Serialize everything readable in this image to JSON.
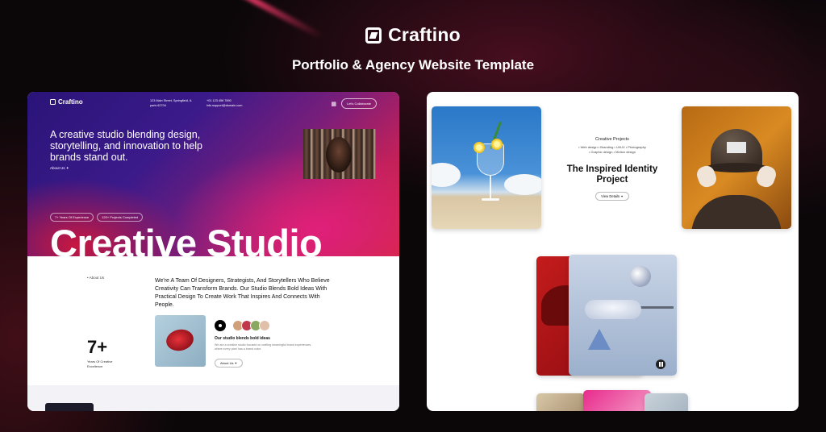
{
  "header": {
    "brand": "Craftino",
    "tagline": "Portfolio & Agency Website Template"
  },
  "left_preview": {
    "nav": {
      "logo": "Craftino",
      "address": "123 Main Street, Springfield, IL paris 62704",
      "contact": "+01 123 456 7890 info.support@domain.com",
      "cta": "Let's Collaborate"
    },
    "intro": "A creative studio blending design, storytelling, and innovation to help brands stand out.",
    "about_link": "About Us",
    "pills": [
      "7+ Years Of Experience",
      "120+ Projects Completed"
    ],
    "big_title": "Creative Studio",
    "about_label": "About Us",
    "statement": "We're A Team Of Designers, Strategists, And Storytellers Who Believe Creativity Can Transform Brands. Our Studio Blends Bold Ideas With Practical Design To Create Work That Inspires And Connects With People.",
    "stat_value": "7+",
    "stat_label": "Years Of Creative Excellence",
    "small_title": "Our studio blends bold ideas",
    "small_text": "We are a creative studio focused on crafting meaningful brand experiences, where every pixel has a brand voice.",
    "about_button": "About Us"
  },
  "right_preview": {
    "category": "Creative Projects",
    "tags": [
      "Web design",
      "Branding",
      "UI/UX",
      "Photography",
      "Graphic design",
      "Motion design"
    ],
    "project_title": "The Inspired Identity Project",
    "view_button": "View Details"
  },
  "colors": {
    "background": "#0b0709",
    "hero_purple": "#2a1478",
    "hero_pink": "#e0207a",
    "hero_red": "#d42a3a"
  }
}
